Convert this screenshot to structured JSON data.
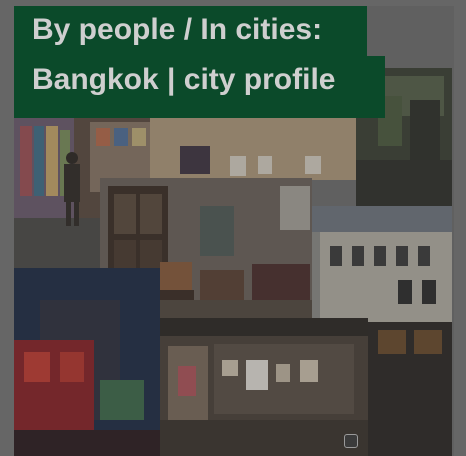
{
  "title": {
    "line1": "By people / In cities:",
    "line2": "Bangkok | city profile"
  },
  "photos": [
    {
      "name": "photo-bookshop",
      "description": "bookshop interior with person browsing shelves"
    },
    {
      "name": "photo-living-room",
      "description": "vintage living room with cabinet and sofa"
    },
    {
      "name": "photo-colonial-building",
      "description": "old colonial building facade"
    },
    {
      "name": "photo-night-street",
      "description": "red lit street corner at night"
    },
    {
      "name": "photo-gallery",
      "description": "art gallery interior with framed works"
    },
    {
      "name": "photo-dark-interior",
      "description": "dark interior corner"
    }
  ],
  "colors": {
    "title_bg": "#0b4a2a",
    "title_text": "#cfcfcf"
  }
}
